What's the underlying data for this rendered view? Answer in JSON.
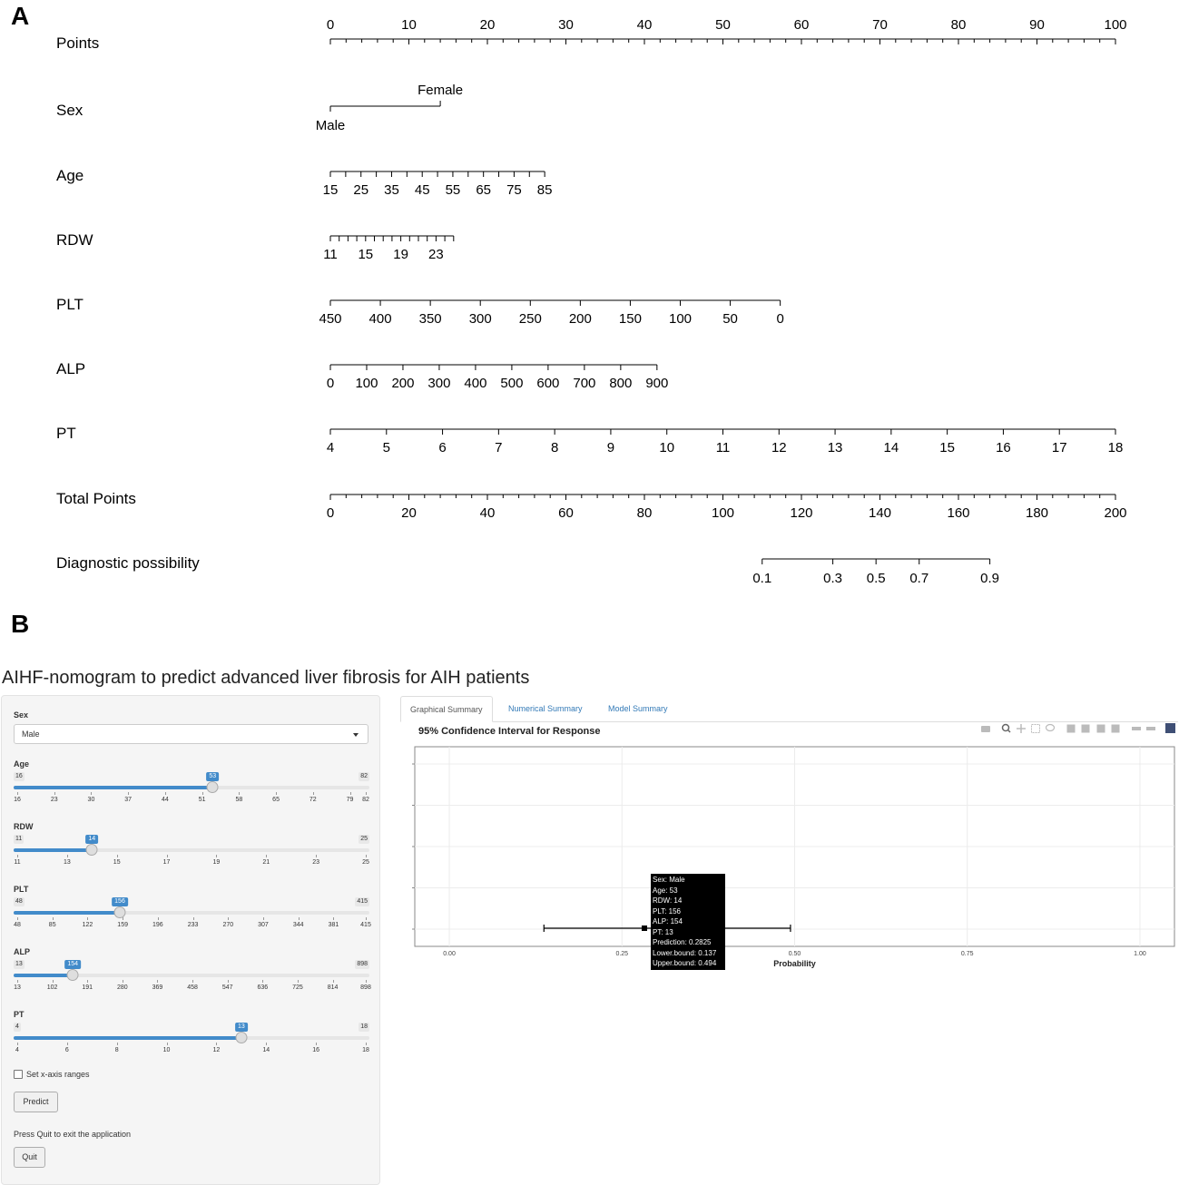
{
  "panel_a_label": "A",
  "panel_b_label": "B",
  "chart_data": [
    {
      "type": "nomogram",
      "rows": [
        {
          "name": "Points",
          "min": 0,
          "max": 100,
          "labels": [
            0,
            10,
            20,
            30,
            40,
            50,
            60,
            70,
            80,
            90,
            100
          ],
          "minor_step": 2
        },
        {
          "name": "Sex",
          "categories": [
            "Male",
            "Female"
          ],
          "points": [
            0,
            14
          ]
        },
        {
          "name": "Age",
          "labels": [
            15,
            25,
            35,
            45,
            55,
            65,
            75,
            85
          ],
          "points_range": [
            0,
            27.3
          ],
          "minor_step": 5
        },
        {
          "name": "RDW",
          "labels": [
            11,
            15,
            19,
            23
          ],
          "points_range": [
            0,
            15.7
          ],
          "tick_min": 11,
          "tick_max": 25
        },
        {
          "name": "PLT",
          "labels": [
            450,
            400,
            350,
            300,
            250,
            200,
            150,
            100,
            50,
            0
          ],
          "points_range": [
            0,
            57.3
          ]
        },
        {
          "name": "ALP",
          "labels": [
            0,
            100,
            200,
            300,
            400,
            500,
            600,
            700,
            800,
            900
          ],
          "points_range": [
            0,
            41.6
          ]
        },
        {
          "name": "PT",
          "labels": [
            4,
            5,
            6,
            7,
            8,
            9,
            10,
            11,
            12,
            13,
            14,
            15,
            16,
            17,
            18
          ],
          "points_range": [
            0,
            100
          ]
        },
        {
          "name": "Total Points",
          "min": 0,
          "max": 200,
          "labels": [
            0,
            20,
            40,
            60,
            80,
            100,
            120,
            140,
            160,
            180,
            200
          ],
          "minor_step": 4
        },
        {
          "name": "Diagnostic possibility",
          "labels": [
            0.1,
            0.3,
            0.5,
            0.7,
            0.9
          ],
          "total_points_at": [
            110,
            128,
            139,
            150,
            168
          ]
        }
      ]
    },
    {
      "type": "errorbar",
      "title": "95% Confidence Interval for Response",
      "xlabel": "Probability",
      "xlim": [
        -0.05,
        1.05
      ],
      "x_ticks": [
        "0.00",
        "0.25",
        "0.50",
        "0.75",
        "1.00"
      ],
      "prediction": 0.2825,
      "lower": 0.137,
      "upper": 0.494,
      "tooltip": [
        "Sex: Male",
        "Age: 53",
        "RDW: 14",
        "PLT: 156",
        "ALP: 154",
        "PT: 13",
        "Prediction: 0.2825",
        "Lower.bound: 0.137",
        "Upper.bound: 0.494"
      ]
    }
  ],
  "app": {
    "title": "AIHF-nomogram to predict advanced liver fibrosis for AIH patients",
    "sex": {
      "label": "Sex",
      "value": "Male"
    },
    "sliders": [
      {
        "label": "Age",
        "min": 16,
        "max": 82,
        "value": 53,
        "ticks": [
          16,
          23,
          30,
          37,
          44,
          51,
          58,
          65,
          72,
          79,
          82
        ]
      },
      {
        "label": "RDW",
        "min": 11,
        "max": 25,
        "value": 14,
        "ticks": [
          11,
          13,
          15,
          17,
          19,
          21,
          23,
          25
        ]
      },
      {
        "label": "PLT",
        "min": 48,
        "max": 415,
        "value": 156,
        "ticks": [
          48,
          85,
          122,
          159,
          196,
          233,
          270,
          307,
          344,
          381,
          415
        ]
      },
      {
        "label": "ALP",
        "min": 13,
        "max": 898,
        "value": 154,
        "ticks": [
          13,
          102,
          191,
          280,
          369,
          458,
          547,
          636,
          725,
          814,
          898
        ]
      },
      {
        "label": "PT",
        "min": 4,
        "max": 18,
        "value": 13,
        "ticks": [
          4,
          6,
          8,
          10,
          12,
          14,
          16,
          18
        ]
      }
    ],
    "xaxis_checkbox": "Set x-axis ranges",
    "predict_label": "Predict",
    "quit_text": "Press Quit to exit the application",
    "quit_label": "Quit",
    "tabs": [
      "Graphical Summary",
      "Numerical Summary",
      "Model Summary"
    ]
  },
  "toolbar_icons": [
    "camera-icon",
    "zoom-icon",
    "pan-icon",
    "box-select-icon",
    "lasso-icon",
    "zoom-in-icon",
    "zoom-out-icon",
    "autoscale-icon",
    "home-icon",
    "spike-icon",
    "compare-icon",
    "plotly-logo-icon"
  ]
}
